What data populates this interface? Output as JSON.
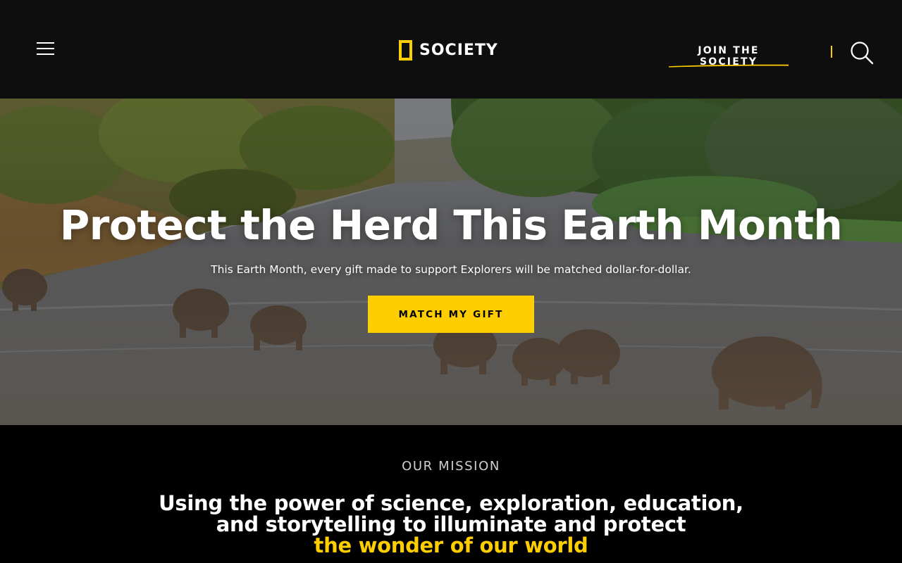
{
  "header": {
    "menu_icon": "hamburger-menu-icon",
    "logo_text": "SOCIETY",
    "join_label": "JOIN THE SOCIETY",
    "search_icon": "search-icon"
  },
  "hero": {
    "title": "Protect the Herd This Earth Month",
    "subtitle": "This Earth Month, every gift made to support Explorers will be matched dollar-for-dollar.",
    "cta_label": "MATCH MY GIFT"
  },
  "mission": {
    "label": "OUR MISSION",
    "line1": "Using the power of science, exploration, education,",
    "line2": "and storytelling to illuminate and protect",
    "line3": "the wonder of our world"
  },
  "colors": {
    "brand_yellow": "#ffce00",
    "header_bg": "#0e0e0f",
    "page_bg": "#000000"
  }
}
